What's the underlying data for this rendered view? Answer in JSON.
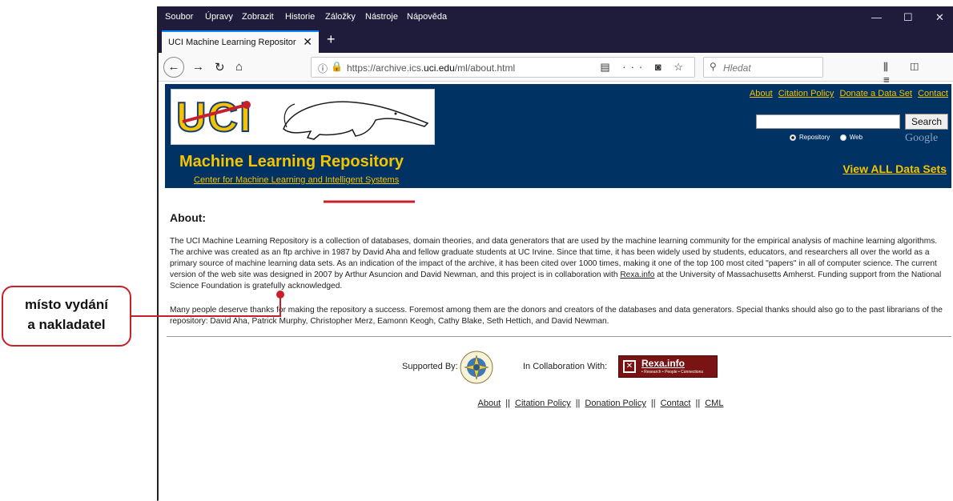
{
  "browser": {
    "menu": [
      "Soubor",
      "Úpravy",
      "Zobrazit",
      "Historie",
      "Záložky",
      "Nástroje",
      "Nápověda"
    ],
    "window_controls": [
      "—",
      "☐",
      "✕"
    ],
    "tab_title": "UCI Machine Learning Repository: A",
    "tab_close": "✕",
    "new_tab": "+",
    "url_prefix": "https://archive.ics.",
    "url_domain": "uci.edu",
    "url_path": "/ml/about.html",
    "url_actions": "▤ ··· ◙ ☆",
    "search_placeholder": "Hledat",
    "toolbar_right": "⫼ ◫ ≡"
  },
  "site": {
    "logo_text": "UCI",
    "title": "Machine Learning Repository",
    "subtitle": "Center for Machine Learning and Intelligent Systems",
    "top_links": [
      "About",
      "Citation Policy",
      "Donate a Data Set",
      "Contact"
    ],
    "search_button": "Search",
    "search_options": [
      "Repository",
      "Web"
    ],
    "search_option_selected": "Repository",
    "google_label": "Google",
    "view_all": "View ALL Data Sets"
  },
  "about": {
    "heading": "About:",
    "para1_a": "The UCI Machine Learning Repository is a collection of databases, domain theories, and data generators that are used by the machine learning community for the empirical analysis of machine learning algorithms. The archive was created as an ftp archive in 1987 by David Aha and fellow graduate students at UC Irvine. Since that time, it has been widely used by students, educators, and researchers all over the world as a primary source of machine learning data sets. As an indication of the impact of the archive, it has been cited over 1000 times, making it one of the top 100 most cited \"papers\" in all of computer science. The current version of the web site was designed in 2007 by Arthur Asuncion and David Newman, and this project is in collaboration with ",
    "para1_link": "Rexa.info",
    "para1_b": " at the University of Massachusetts Amherst. Funding support from the National Science Foundation is gratefully acknowledged.",
    "para2": "Many people deserve thanks for making the repository a success. Foremost among them are the donors and creators of the databases and data generators. Special thanks should also go to the past librarians of the repository: David Aha, Patrick Murphy, Christopher Merz, Eamonn Keogh, Cathy Blake, Seth Hettich, and David Newman."
  },
  "footer": {
    "supported_by": "Supported By:",
    "collaboration": "In Collaboration With:",
    "rexa_name": "Rexa.info",
    "rexa_tagline": "• Research • People • Connections",
    "links": [
      "About",
      "Citation Policy",
      "Donation Policy",
      "Contact",
      "CML"
    ],
    "separator": "||"
  },
  "annotation": {
    "line1": "místo vydání",
    "line2": "a nakladatel",
    "accent_color": "#c8202a"
  },
  "colors": {
    "header_bg": "#003263",
    "header_text": "#f5c400",
    "browser_chrome": "#1e1c3a"
  }
}
